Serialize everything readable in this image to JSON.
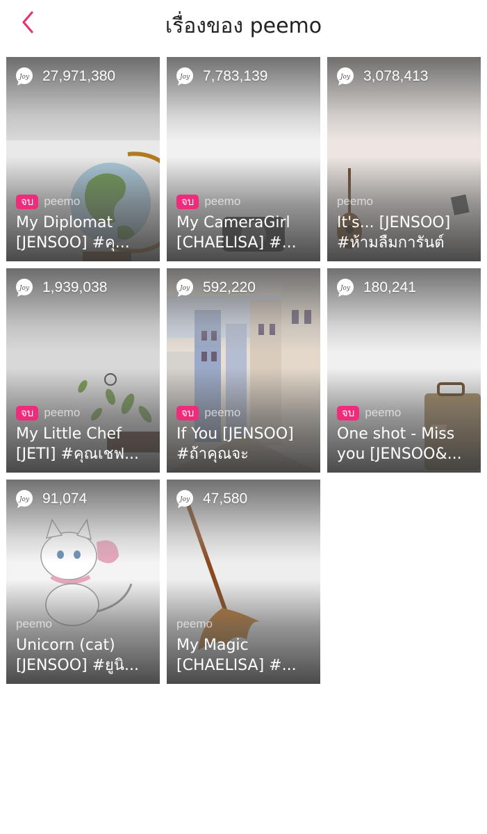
{
  "header": {
    "title": "เรื่องของ peemo"
  },
  "stories": [
    {
      "views": "27,971,380",
      "finished": true,
      "badge": "จบ",
      "author": "peemo",
      "title": "My Diplomat [JENSOO] #คุ...",
      "cover": "globe"
    },
    {
      "views": "7,783,139",
      "finished": true,
      "badge": "จบ",
      "author": "peemo",
      "title": "My CameraGirl [CHAELISA] #...",
      "cover": "camera"
    },
    {
      "views": "3,078,413",
      "finished": false,
      "badge": "",
      "author": "peemo",
      "title": "It's... [JENSOO] #ห้ามลืมการันต์",
      "cover": "guitar"
    },
    {
      "views": "1,939,038",
      "finished": true,
      "badge": "จบ",
      "author": "peemo",
      "title": "My Little Chef [JETI] #คุณเชฟ...",
      "cover": "leaves"
    },
    {
      "views": "592,220",
      "finished": true,
      "badge": "จบ",
      "author": "peemo",
      "title": "If You [JENSOO] #ถ้าคุณจะ",
      "cover": "city"
    },
    {
      "views": "180,241",
      "finished": true,
      "badge": "จบ",
      "author": "peemo",
      "title": "One shot - Miss you [JENSOO&...",
      "cover": "suitcase"
    },
    {
      "views": "91,074",
      "finished": false,
      "badge": "",
      "author": "peemo",
      "title": "Unicorn (cat) [JENSOO] #ยูนิ...",
      "cover": "cat"
    },
    {
      "views": "47,580",
      "finished": false,
      "badge": "",
      "author": "peemo",
      "title": "My Magic [CHAELISA] #...",
      "cover": "broom"
    }
  ],
  "colors": {
    "accent": "#ef2b7c",
    "back": "#e8336f"
  },
  "icons": {
    "back": "chevron-left-icon",
    "views": "joy-icon"
  }
}
